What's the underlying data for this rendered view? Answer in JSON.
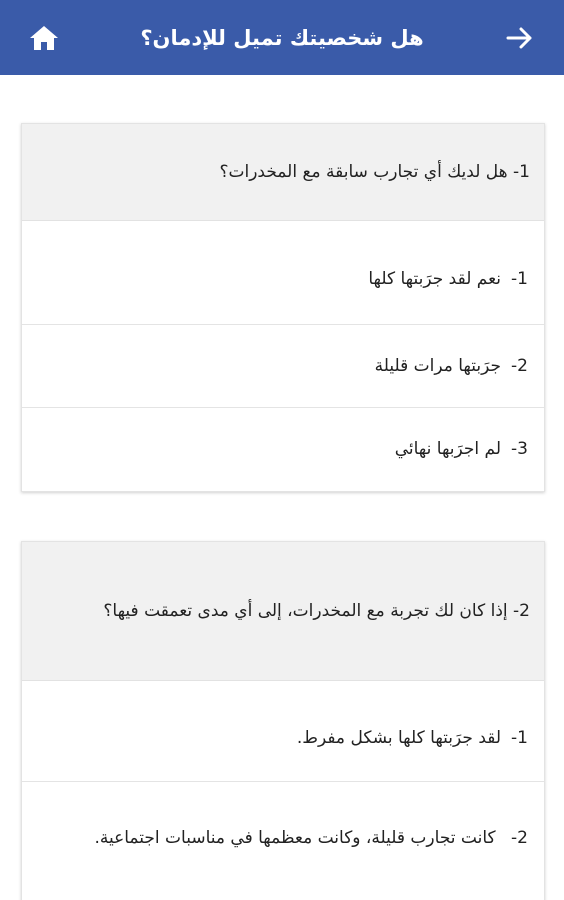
{
  "header": {
    "title": "هل شخصيتك تميل للإدمان؟",
    "home_icon": "home-icon",
    "back_icon": "arrow-right-icon",
    "background": "#3a5ba9"
  },
  "questions": [
    {
      "number": "1-",
      "text": "هل لديك أي تجارب سابقة مع المخدرات؟",
      "options": [
        {
          "number": "1-",
          "text": "نعم لقد جرَبتها كلها"
        },
        {
          "number": "2-",
          "text": "جرَبتها مرات قليلة"
        },
        {
          "number": "3-",
          "text": "لم اجرَبها نهائي"
        }
      ]
    },
    {
      "number": "2-",
      "text": "إذا كان لك تجربة مع المخدرات، إلى أي مدى تعمقت فيها؟",
      "options": [
        {
          "number": "1-",
          "text": "لقد جرَبتها كلها بشكل مفرط."
        },
        {
          "number": "2-",
          "text": "كانت تجارب قليلة، وكانت معظمها في مناسبات اجتماعية."
        }
      ]
    }
  ]
}
